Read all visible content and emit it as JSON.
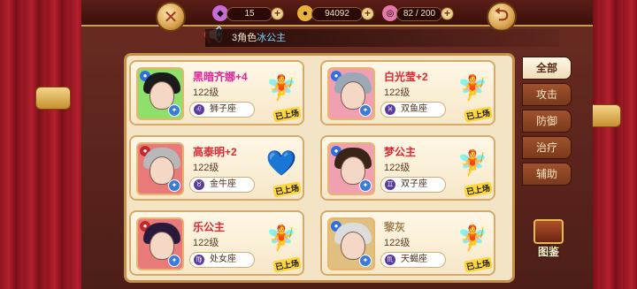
{
  "header": {
    "gems": "15",
    "gold": "94092",
    "stamina": "82 / 200"
  },
  "notice": {
    "prefix": "3角色",
    "highlight": "冰公主"
  },
  "tabs": [
    {
      "label": "全部",
      "active": true
    },
    {
      "label": "攻击",
      "active": false
    },
    {
      "label": "防御",
      "active": false
    },
    {
      "label": "治疗",
      "active": false
    },
    {
      "label": "辅助",
      "active": false
    }
  ],
  "codex_label": "图鉴",
  "cards": [
    {
      "name": "黑暗齐娜+4",
      "name_color": "#e0259a",
      "level": "122级",
      "zodiac": "狮子座",
      "zodiac_icon": "♌",
      "status": "已上场",
      "portrait_bg": "#8fe06a",
      "hair": "#1b1b1b",
      "element_color": "#2f6fe0",
      "fairy": "red-fairy"
    },
    {
      "name": "白光莹+2",
      "name_color": "#e0262f",
      "level": "122级",
      "zodiac": "双鱼座",
      "zodiac_icon": "♓",
      "status": "已上场",
      "portrait_bg": "#f0a0b0",
      "hair": "#9aa8b8",
      "element_color": "#2f6fe0",
      "fairy": "pink-fairy"
    },
    {
      "name": "高泰明+2",
      "name_color": "#e0262f",
      "level": "122级",
      "zodiac": "金牛座",
      "zodiac_icon": "♉",
      "status": "已上场",
      "portrait_bg": "#e87a7a",
      "hair": "#b8b8b8",
      "element_color": "#c02a2a",
      "fairy": "blue-heart"
    },
    {
      "name": "梦公主",
      "name_color": "#e0262f",
      "level": "122级",
      "zodiac": "双子座",
      "zodiac_icon": "♊",
      "status": "已上场",
      "portrait_bg": "#f0a0b0",
      "hair": "#3a2418",
      "element_color": "#2f6fe0",
      "fairy": "pink-fairy"
    },
    {
      "name": "乐公主",
      "name_color": "#e0262f",
      "level": "122级",
      "zodiac": "处女座",
      "zodiac_icon": "♍",
      "status": "已上场",
      "portrait_bg": "#e87a7a",
      "hair": "#2a1a3a",
      "element_color": "#c02a2a",
      "fairy": "red-fairy"
    },
    {
      "name": "黎灰",
      "name_color": "#a08050",
      "level": "122级",
      "zodiac": "天蝎座",
      "zodiac_icon": "♏",
      "status": "已上场",
      "portrait_bg": "#e0c080",
      "hair": "#dcdcdc",
      "element_color": "#2f6fe0",
      "fairy": "blue-fairy"
    }
  ]
}
